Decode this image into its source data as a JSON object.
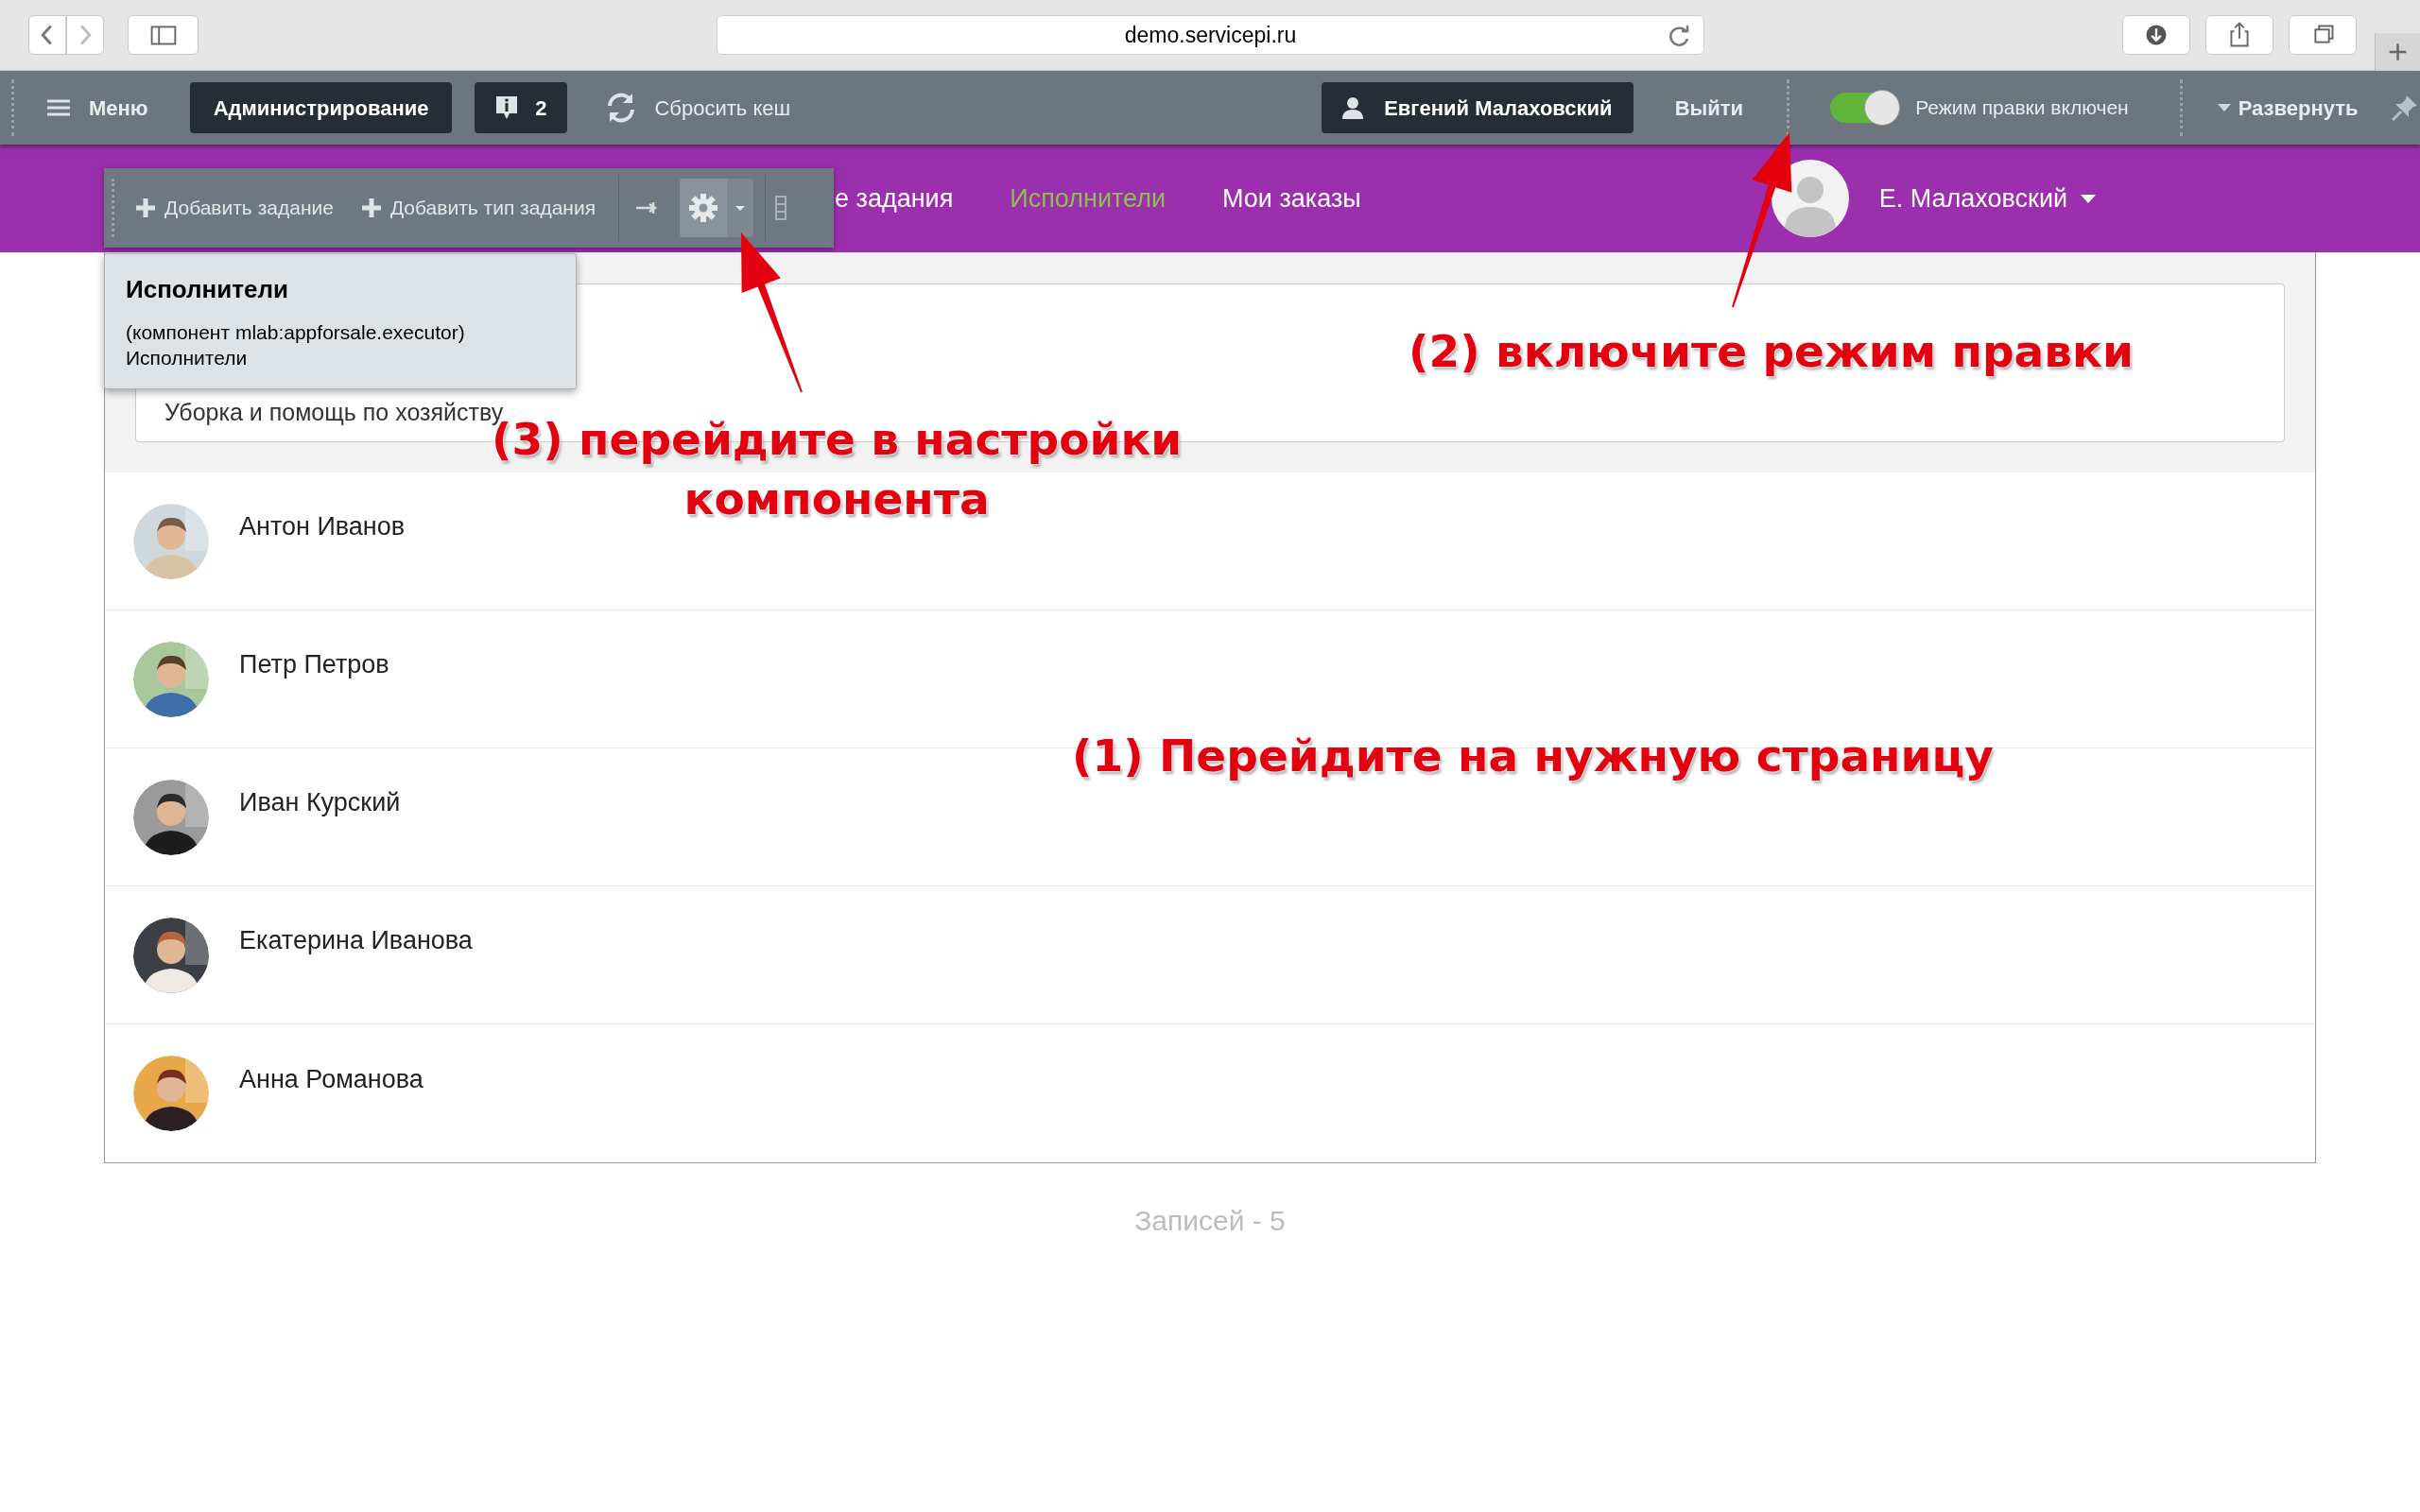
{
  "browser": {
    "url": "demo.servicepi.ru"
  },
  "admin_bar": {
    "menu": "Меню",
    "admin": "Администрирование",
    "notifications": "2",
    "clear_cache": "Сбросить кеш",
    "user": "Евгений Малаховский",
    "logout": "Выйти",
    "edit_mode": {
      "label": "Режим правки включен",
      "on": true
    },
    "expand": "Развернуть"
  },
  "nav": {
    "items": [
      {
        "label": "е задания",
        "selected": false
      },
      {
        "label": "Исполнители",
        "selected": true
      },
      {
        "label": "Мои заказы",
        "selected": false
      }
    ],
    "user": "Е. Малаховский"
  },
  "component_toolbar": {
    "buttons": [
      "Добавить задание",
      "Добавить тип задания"
    ]
  },
  "tooltip": {
    "title": "Исполнители",
    "lines": [
      "(компонент mlab:appforsale.executor)",
      "Исполнители"
    ]
  },
  "filter": {
    "visible_item": "Уборка и помощь по хозяйству"
  },
  "executors": [
    {
      "name": "Антон Иванов",
      "kind": "picture"
    },
    {
      "name": "Петр Петров",
      "kind": "picture"
    },
    {
      "name": "Иван Курский",
      "kind": "picture"
    },
    {
      "name": "Екатерина Иванова",
      "kind": "picture"
    },
    {
      "name": "Анна Романова",
      "kind": "picture"
    }
  ],
  "footer": "Записей - 5",
  "annotations": [
    {
      "kind": "edit-mode",
      "lines": [
        "(2) включите режим правки"
      ]
    },
    {
      "kind": "settings",
      "lines": [
        "(3) перейдите в настройки",
        "компонента"
      ]
    },
    {
      "kind": "page",
      "lines": [
        "(1) Перейдите на нужную страницу"
      ]
    }
  ]
}
